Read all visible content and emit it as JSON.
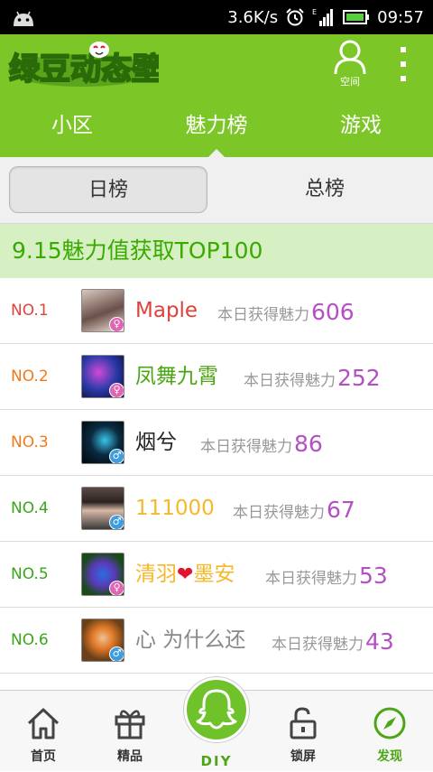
{
  "status_bar": {
    "speed": "3.6K/s",
    "time": "09:57"
  },
  "app_bar": {
    "logo_text": "绿豆动态壁纸",
    "space_label": "空间"
  },
  "tabs": [
    {
      "label": "小区",
      "active": false
    },
    {
      "label": "魅力榜",
      "active": true
    },
    {
      "label": "游戏",
      "active": false
    }
  ],
  "segments": {
    "daily": "日榜",
    "total": "总榜"
  },
  "banner": {
    "text": "9.15魅力值获取TOP100"
  },
  "charm_label": "本日获得魅力",
  "leaderboard": [
    {
      "rank": "NO.1",
      "name": "Maple",
      "gender": "♀",
      "charm": "606",
      "rank_color": "#e0423a",
      "name_color": "#e0423a"
    },
    {
      "rank": "NO.2",
      "name": "凤舞九霄",
      "gender": "♀",
      "charm": "252",
      "rank_color": "#f07a1a",
      "name_color": "#4ca614"
    },
    {
      "rank": "NO.3",
      "name": "烟兮",
      "gender": "♂",
      "charm": "86",
      "rank_color": "#f07a1a",
      "name_color": "#222222"
    },
    {
      "rank": "NO.4",
      "name": "111000",
      "gender": "♂",
      "charm": "67",
      "rank_color": "#3aa61a",
      "name_color": "#f5b82a"
    },
    {
      "rank": "NO.5",
      "name_part1": "清羽",
      "name_heart": "❤",
      "name_part2": "墨安",
      "gender": "♀",
      "charm": "53",
      "rank_color": "#3aa61a",
      "name_color": "#f5b82a"
    },
    {
      "rank": "NO.6",
      "name": "心 为什么还",
      "gender": "♂",
      "charm": "43",
      "rank_color": "#3aa61a",
      "name_color": "#888888"
    }
  ],
  "bottom_nav": {
    "home": "首页",
    "featured": "精品",
    "diy": "DIY",
    "lock": "锁屏",
    "discover": "发现"
  },
  "colors": {
    "brand_green": "#7cc628",
    "charm_purple": "#b44fc4",
    "female": "#e064b4",
    "male": "#3d9be0"
  }
}
